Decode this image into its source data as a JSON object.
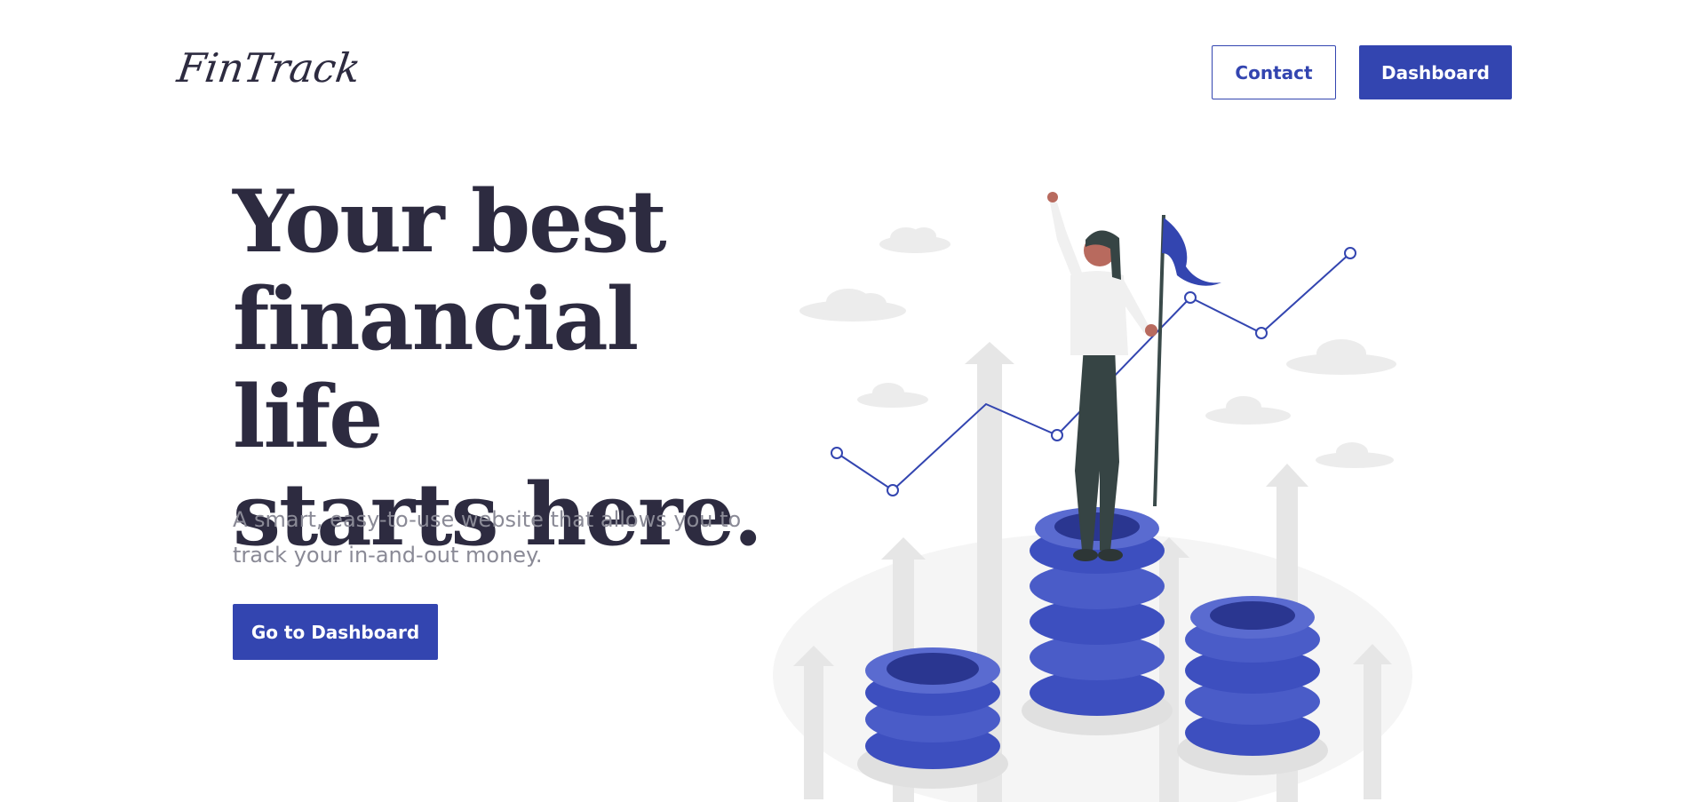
{
  "brand": {
    "logo_text": "FinTrack"
  },
  "nav": {
    "contact_label": "Contact",
    "dashboard_label": "Dashboard"
  },
  "hero": {
    "title_line1": "Your best",
    "title_line2": "financial life",
    "title_line3": "starts here.",
    "subtitle": "A smart, easy-to-use website that allows you to track your in-and-out money.",
    "cta_label": "Go to Dashboard"
  },
  "colors": {
    "primary": "#3345b0",
    "heading": "#2d2b40",
    "muted_text": "#8a8a96",
    "coin": "#5a6bd0",
    "coin_dark": "#2a3690"
  },
  "illustration": {
    "name": "woman-on-coin-stacks-with-flag"
  }
}
